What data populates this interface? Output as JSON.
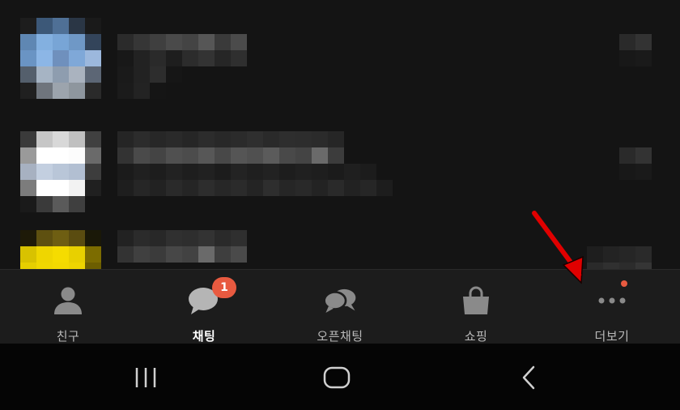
{
  "chat_list": {
    "rows": [
      {
        "name": "chat-item-1"
      },
      {
        "name": "chat-item-2"
      },
      {
        "name": "chat-item-3"
      }
    ]
  },
  "tab_bar": {
    "tabs": [
      {
        "id": "friends",
        "label": "친구",
        "icon": "person-icon",
        "active": false
      },
      {
        "id": "chats",
        "label": "채팅",
        "icon": "chat-bubble-icon",
        "active": true
      },
      {
        "id": "openchat",
        "label": "오픈채팅",
        "icon": "open-chat-icon",
        "active": false
      },
      {
        "id": "shopping",
        "label": "쇼핑",
        "icon": "shopping-bag-icon",
        "active": false
      },
      {
        "id": "more",
        "label": "더보기",
        "icon": "more-dots-icon",
        "active": false
      }
    ],
    "chat_badge": "1",
    "colors": {
      "background": "#1c1c1c",
      "icon": "#8a8a8a",
      "label": "#b9b9b9",
      "active_label": "#ffffff",
      "badge": "#e85a40"
    }
  },
  "annotation": {
    "arrow_color": "#e00000"
  },
  "nav_bar": {
    "buttons": [
      "recent-apps-icon",
      "home-icon",
      "back-icon"
    ]
  }
}
